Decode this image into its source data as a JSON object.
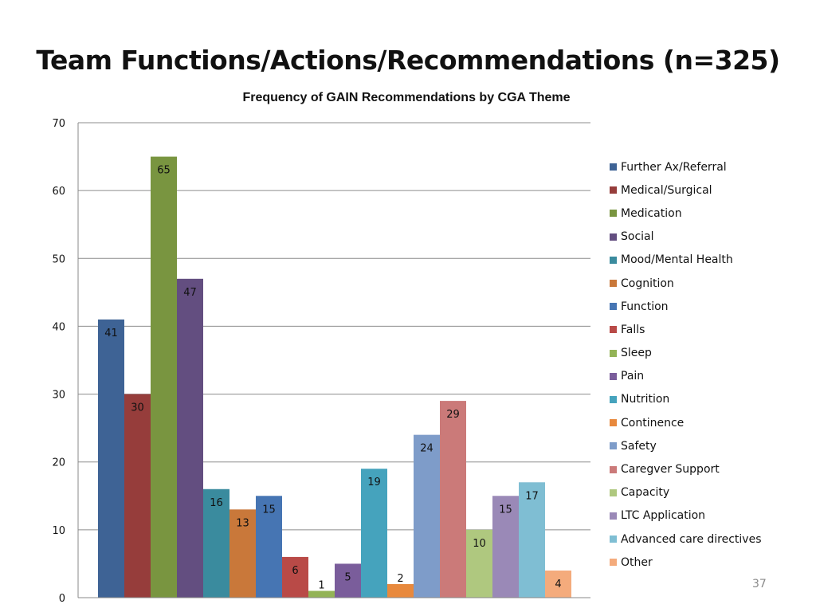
{
  "slide": {
    "title": "Team Functions/Actions/Recommendations (n=325)",
    "page_number": "37"
  },
  "chart_data": {
    "type": "bar",
    "title": "Frequency of GAIN Recommendations by CGA Theme",
    "xlabel": "",
    "ylabel": "",
    "ylim": [
      0,
      70
    ],
    "yticks": [
      0,
      10,
      20,
      30,
      40,
      50,
      60,
      70
    ],
    "grid": true,
    "legend_position": "right",
    "categories": [
      ""
    ],
    "series": [
      {
        "name": "Further Ax/Referral",
        "values": [
          41
        ],
        "color": "#3e6395"
      },
      {
        "name": "Medical/Surgical",
        "values": [
          30
        ],
        "color": "#963d3b"
      },
      {
        "name": "Medication",
        "values": [
          65
        ],
        "color": "#799540"
      },
      {
        "name": "Social",
        "values": [
          47
        ],
        "color": "#634e80"
      },
      {
        "name": "Mood/Mental Health",
        "values": [
          16
        ],
        "color": "#3a8b9e"
      },
      {
        "name": "Cognition",
        "values": [
          13
        ],
        "color": "#c9783a"
      },
      {
        "name": "Function",
        "values": [
          15
        ],
        "color": "#4675b3"
      },
      {
        "name": "Falls",
        "values": [
          6
        ],
        "color": "#b94a47"
      },
      {
        "name": "Sleep",
        "values": [
          1
        ],
        "color": "#93b356"
      },
      {
        "name": "Pain",
        "values": [
          5
        ],
        "color": "#7a5d9b"
      },
      {
        "name": "Nutrition",
        "values": [
          19
        ],
        "color": "#45a3bd"
      },
      {
        "name": "Continence",
        "values": [
          2
        ],
        "color": "#e8893d"
      },
      {
        "name": "Safety",
        "values": [
          24
        ],
        "color": "#7e9cc9"
      },
      {
        "name": "Caregver Support",
        "values": [
          29
        ],
        "color": "#cb7a79"
      },
      {
        "name": "Capacity",
        "values": [
          10
        ],
        "color": "#afc87f"
      },
      {
        "name": "LTC Application",
        "values": [
          15
        ],
        "color": "#9a89b7"
      },
      {
        "name": "Advanced care directives",
        "values": [
          17
        ],
        "color": "#7fbed3"
      },
      {
        "name": "Other",
        "values": [
          4
        ],
        "color": "#f4ab7c"
      }
    ]
  }
}
